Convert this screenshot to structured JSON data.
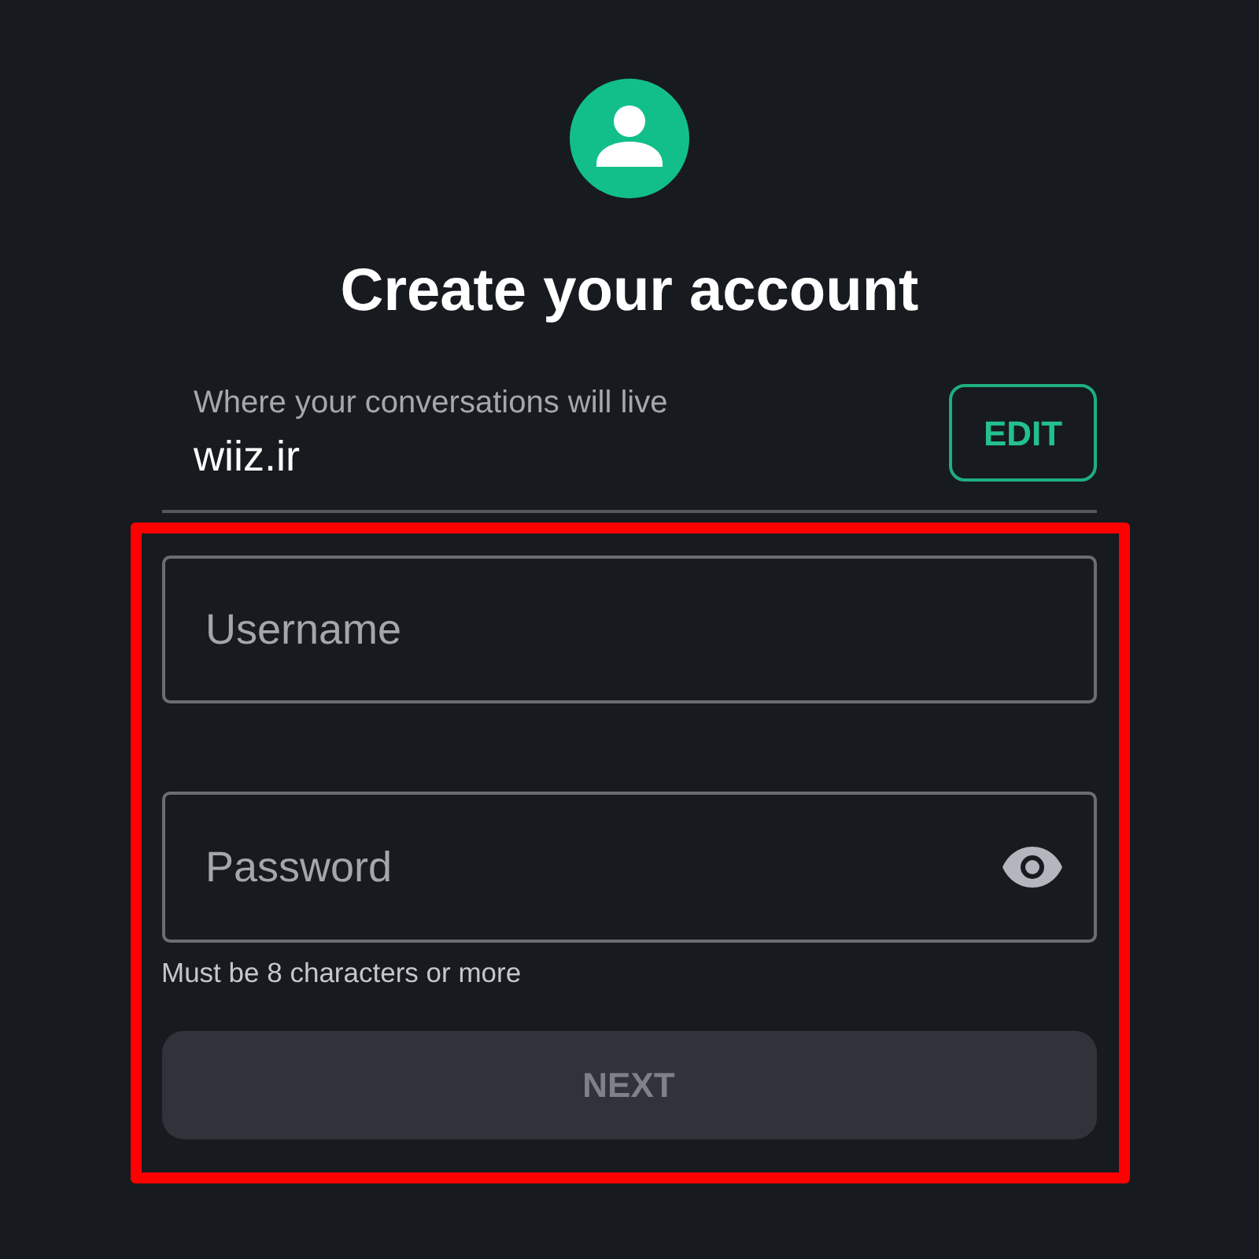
{
  "header": {
    "title": "Create your account"
  },
  "server": {
    "label": "Where your conversations will live",
    "value": "wiiz.ir",
    "edit_button": "EDIT"
  },
  "fields": [
    {
      "kind": "text",
      "placeholder": "Username"
    },
    {
      "kind": "password",
      "placeholder": "Password",
      "helper": "Must be 8 characters or more"
    }
  ],
  "next_button": {
    "label": "NEXT",
    "disabled": true
  }
}
